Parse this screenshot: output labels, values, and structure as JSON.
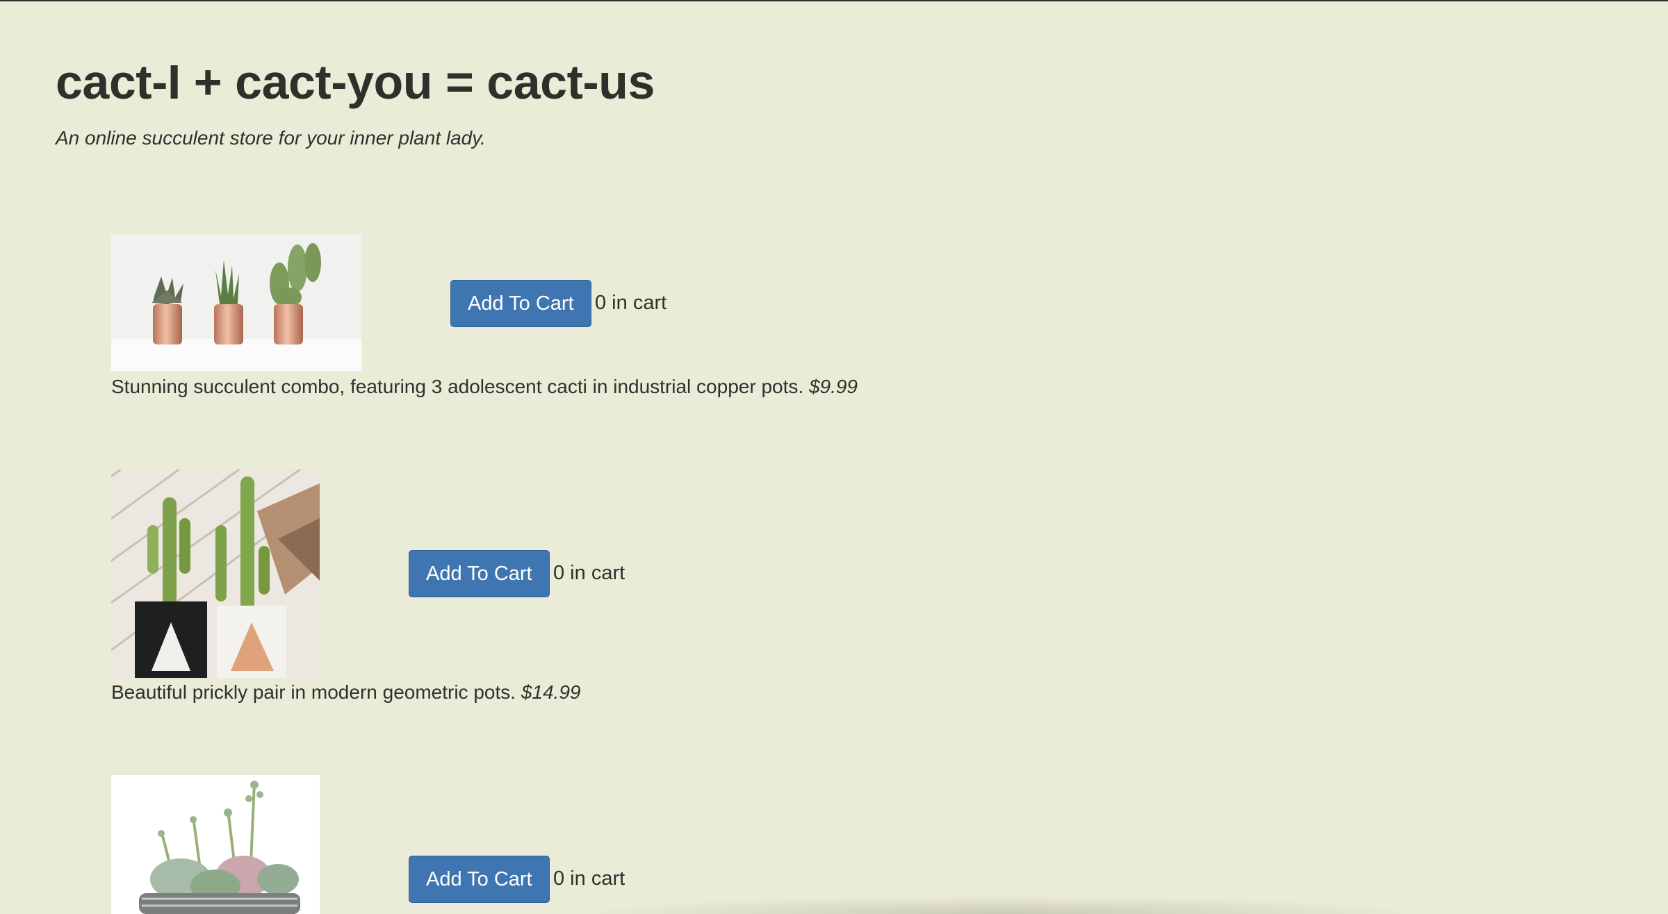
{
  "header": {
    "title": "cact-I + cact-you = cact-us",
    "tagline": "An online succulent store for your inner plant lady."
  },
  "products": [
    {
      "image_alt": "three small cacti in copper pots",
      "button_label": "Add To Cart",
      "cart_count": "0 in cart",
      "description": "Stunning succulent combo, featuring 3 adolescent cacti in industrial copper pots.",
      "price": "$9.99"
    },
    {
      "image_alt": "two tall cacti in geometric pots",
      "button_label": "Add To Cart",
      "cart_count": "0 in cart",
      "description": "Beautiful prickly pair in modern geometric pots.",
      "price": "$14.99"
    },
    {
      "image_alt": "succulent arrangement in a round planter",
      "button_label": "Add To Cart",
      "cart_count": "0 in cart"
    }
  ],
  "colors": {
    "background": "#ebecd7",
    "button": "#3f75b1",
    "text": "#2f302c"
  }
}
